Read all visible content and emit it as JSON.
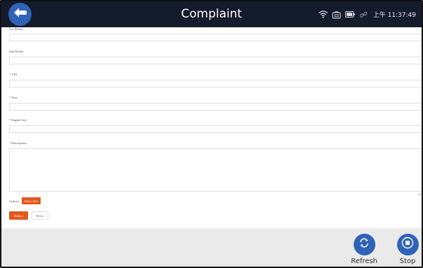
{
  "header": {
    "title": "Complaint",
    "time": "上午 11:37:49",
    "status_icons": [
      "wifi-icon",
      "bluetooth-box-icon",
      "battery-icon",
      "link-icon"
    ]
  },
  "form": {
    "top_label": "Car Model",
    "sub_model_label": "Sub Model",
    "vin_label": "VIN",
    "year_label": "Year",
    "engine_size_label": "Engine Size",
    "description_label": "Description",
    "required_mark": "*",
    "upload_label": "Upload",
    "select_file_label": "Select File",
    "submit_label": "Submit",
    "reset_label": "Reset"
  },
  "bottom_bar": {
    "refresh_label": "Refresh",
    "stop_label": "Stop"
  },
  "colors": {
    "header_bg": "#141b2b",
    "accent_blue": "#2f63b8",
    "accent_orange": "#e2571a",
    "bottom_bg": "#eaeaea"
  }
}
